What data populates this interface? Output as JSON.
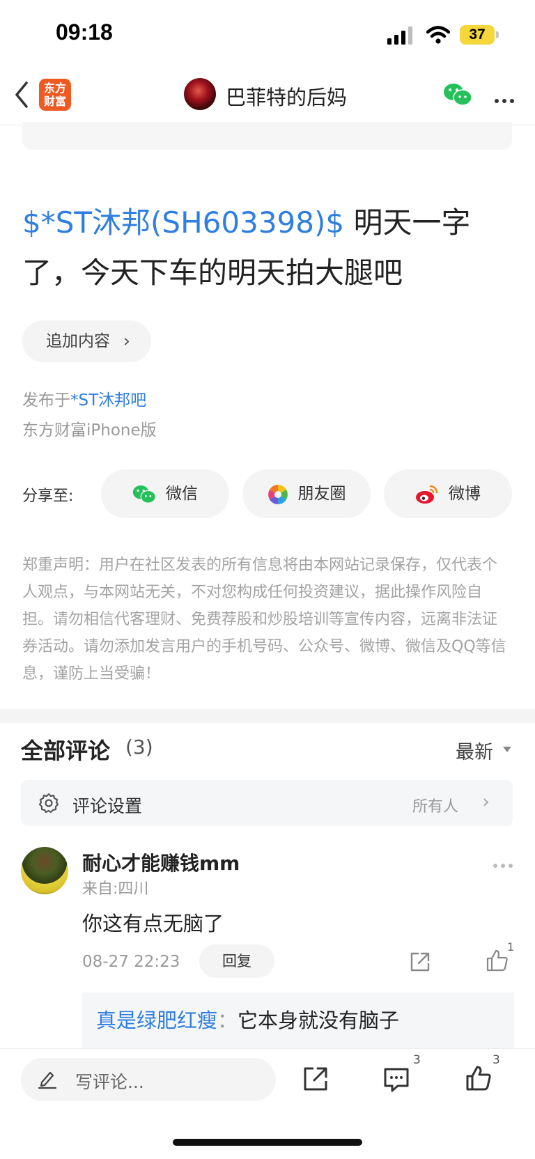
{
  "status_bar": {
    "time": "09:18",
    "battery": "37"
  },
  "nav": {
    "app_logo": "东方\n财富",
    "title": "巴菲特的后妈"
  },
  "post": {
    "stock_tag": "$*ST沐邦(SH603398)$",
    "text": " 明天一字了，今天下车的明天拍大腿吧",
    "append_label": "追加内容",
    "published_prefix": "发布于",
    "published_forum": "*ST沐邦吧",
    "client": "东方财富iPhone版"
  },
  "share": {
    "label": "分享至:",
    "items": [
      {
        "label": "微信",
        "icon": "wechat-icon"
      },
      {
        "label": "朋友圈",
        "icon": "moments-icon"
      },
      {
        "label": "微博",
        "icon": "weibo-icon"
      }
    ]
  },
  "disclaimer": "郑重声明：用户在社区发表的所有信息将由本网站记录保存，仅代表个人观点，与本网站无关，不对您构成任何投资建议，据此操作风险自担。请勿相信代客理财、免费荐股和炒股培训等宣传内容，远离非法证券活动。请勿添加发言用户的手机号码、公众号、微博、微信及QQ等信息，谨防上当受骗！",
  "comments": {
    "title": "全部评论",
    "count": "(3)",
    "sort": "最新",
    "settings_label": "评论设置",
    "settings_value": "所有人",
    "items": [
      {
        "user": "耐心才能赚钱mm",
        "location": "来自:四川",
        "text": "你这有点无脑了",
        "time": "08-27 22:23",
        "reply_label": "回复",
        "likes": "1",
        "replies": [
          {
            "user": "真是绿肥红瘦",
            "sep": "：",
            "text": "它本身就没有脑子"
          }
        ]
      }
    ]
  },
  "bottom_bar": {
    "write_placeholder": "写评论...",
    "comment_count": "3",
    "like_count": "3"
  },
  "colors": {
    "accent": "#2f7ee0",
    "logo": "#ef5a22",
    "battery": "#f5d63b",
    "wechat": "#25c05a"
  }
}
